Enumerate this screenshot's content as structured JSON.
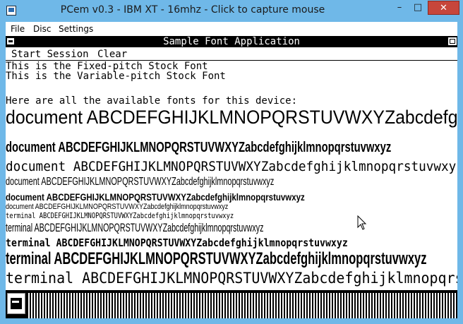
{
  "window": {
    "title": "PCem v0.3 - IBM XT - 16mhz - Click to capture mouse",
    "controls": {
      "minimize": "–",
      "maximize": "□",
      "close": "✕"
    }
  },
  "menu": [
    "File",
    "Disc",
    "Settings"
  ],
  "app": {
    "title": "Sample Font Application",
    "menu": [
      "Start Session",
      "Clear"
    ],
    "lines": [
      "This is the Fixed-pitch Stock Font",
      "This is the Variable-pitch Stock Font",
      "Here are all the available fonts for this device:"
    ],
    "font_samples": [
      "document  ABCDEFGHIJKLMNOPQRSTUVWXYZabcdefghijklmnopqrstuvwxyz",
      "document  ABCDEFGHIJKLMNOPQRSTUVWXYZabcdefghijklmnopqrstuvwxyz",
      "document  ABCDEFGHIJKLMNOPQRSTUVWXYZabcdefghijklmnopqrstuvwxyz",
      "document  ABCDEFGHIJKLMNOPQRSTUVWXYZabcdefghijklmnopqrstuvwxyz",
      "document  ABCDEFGHIJKLMNOPQRSTUVWXYZabcdefghijklmnopqrstuvwxyz",
      "document  ABCDEFGHIJKLMNOPQRSTUVWXYZabcdefghijklmnopqrstuvwxyz",
      "terminal  ABCDEFGHIJKLMNOPQRSTUVWXYZabcdefghijklmnopqrstuvwxyz",
      "terminal  ABCDEFGHIJKLMNOPQRSTUVWXYZabcdefghijklmnopqrstuvwxyz",
      "terminal  ABCDEFGHIJKLMNOPQRSTUVWXYZabcdefghijklmnopqrstuvwxyz",
      "terminal  ABCDEFGHIJKLMNOPQRSTUVWXYZabcdefghijklmnopqrstuvwxyz",
      "terminal  ABCDEFGHIJKLMNOPQRSTUVWXYZabcdefghijklmnopqrstuvwxyz"
    ]
  }
}
